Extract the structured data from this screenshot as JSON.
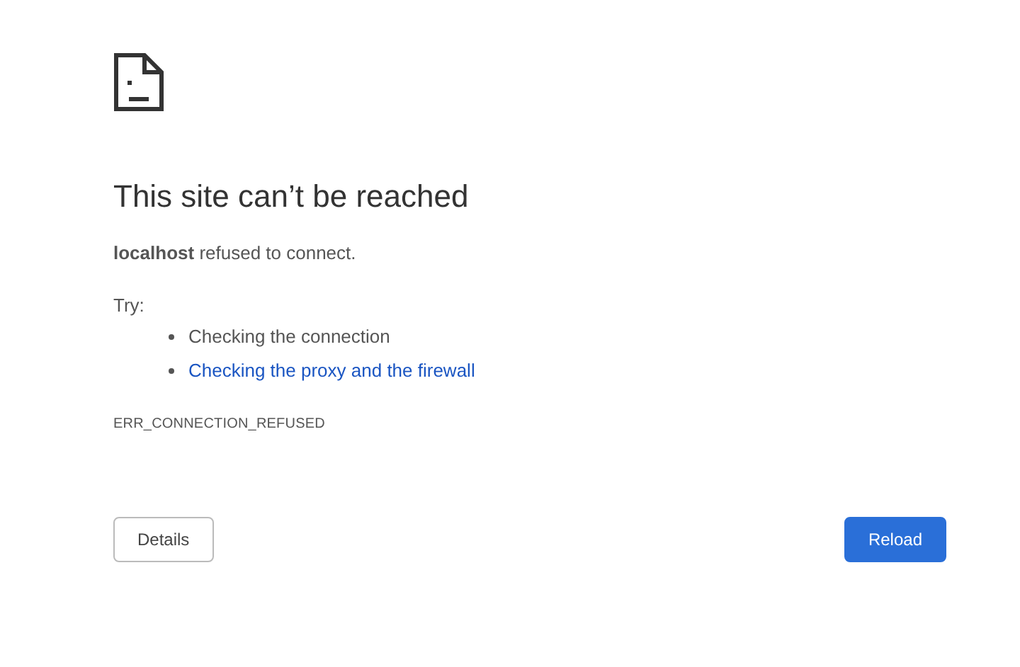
{
  "heading": "This site can’t be reached",
  "message": "**localhost** refused to connect.",
  "try_label": "Try:",
  "suggestions": [
    {
      "text": "Checking the connection",
      "kind": "plain"
    },
    {
      "text": "Checking the proxy and the firewall",
      "kind": "link"
    }
  ],
  "error_code": "ERR_CONNECTION_REFUSED",
  "buttons": [
    {
      "label": "Details",
      "kind": "secondary"
    },
    {
      "label": "Reload",
      "kind": "primary"
    }
  ]
}
